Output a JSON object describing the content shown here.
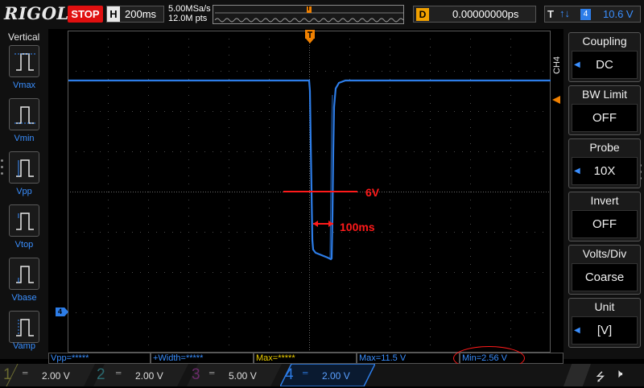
{
  "top_bar": {
    "brand": "RIGOL",
    "run_state": "STOP",
    "horizontal_label": "H",
    "timebase": "200ms",
    "sample_rate": "5.00MSa/s",
    "memory_depth": "12.0M pts",
    "trigger_position_marker": "T",
    "delay_label": "D",
    "delay_value": "0.00000000ps",
    "trigger_label": "T",
    "trigger_slope_icon": "rising-falling-edge-icon",
    "trigger_source": "4",
    "trigger_level": "10.6 V"
  },
  "left_panel": {
    "title": "Vertical",
    "items": [
      {
        "label": "Vmax",
        "icon": "vmax-icon"
      },
      {
        "label": "Vmin",
        "icon": "vmin-icon"
      },
      {
        "label": "Vpp",
        "icon": "vpp-icon"
      },
      {
        "label": "Vtop",
        "icon": "vtop-icon"
      },
      {
        "label": "Vbase",
        "icon": "vbase-icon"
      },
      {
        "label": "Vamp",
        "icon": "vamp-icon"
      }
    ]
  },
  "annotations": {
    "level_label": "6V",
    "duration_label": "100ms"
  },
  "channel_marker": "4",
  "right_panel": {
    "channel_tab": "CH4",
    "items": [
      {
        "title": "Coupling",
        "value": "DC",
        "has_arrow": true
      },
      {
        "title": "BW Limit",
        "value": "OFF",
        "has_arrow": false
      },
      {
        "title": "Probe",
        "value": "10X",
        "has_arrow": true
      },
      {
        "title": "Invert",
        "value": "OFF",
        "has_arrow": false
      },
      {
        "title": "Volts/Div",
        "value": "Coarse",
        "has_arrow": false
      },
      {
        "title": "Unit",
        "value": "[V]",
        "has_arrow": true
      }
    ]
  },
  "measurements": [
    {
      "text": "Vpp=*****",
      "color": "#3a8fff"
    },
    {
      "text": "+Width=*****",
      "color": "#3a8fff"
    },
    {
      "text": "Max=*****",
      "color": "#f0d000"
    },
    {
      "text": "Max=11.5 V",
      "color": "#3a8fff"
    },
    {
      "text": "Min=2.56 V",
      "color": "#3a8fff"
    }
  ],
  "channels": [
    {
      "number": "1",
      "scale": "2.00 V",
      "color": "#6a6a30",
      "active": false
    },
    {
      "number": "2",
      "scale": "2.00 V",
      "color": "#2a6a70",
      "active": false
    },
    {
      "number": "3",
      "scale": "5.00 V",
      "color": "#6a2a6a",
      "active": false
    },
    {
      "number": "4",
      "scale": "2.00 V",
      "color": "#2d7de8",
      "active": true
    }
  ],
  "status_icons": {
    "usb": "usb-icon",
    "speaker": "speaker-mute-icon"
  },
  "colors": {
    "ch4": "#2d7de8",
    "trigger": "#f08000",
    "annotation": "#ff1a1a",
    "stop": "#e01010"
  }
}
